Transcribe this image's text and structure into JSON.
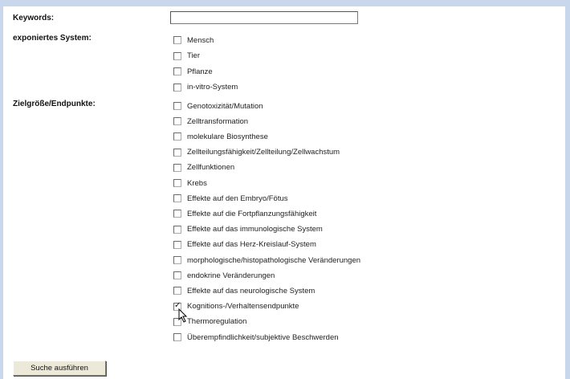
{
  "form": {
    "keywords_label": "Keywords:",
    "keywords_value": "",
    "exposed_system_label": "exponiertes System:",
    "endpoints_label": "Zielgröße/Endpunkte:",
    "submit_label": "Suche ausführen"
  },
  "exposed_systems": [
    {
      "label": "Mensch",
      "checked": false
    },
    {
      "label": "Tier",
      "checked": false
    },
    {
      "label": "Pflanze",
      "checked": false
    },
    {
      "label": "in-vitro-System",
      "checked": false
    }
  ],
  "endpoints": [
    {
      "label": "Genotoxizität/Mutation",
      "checked": false
    },
    {
      "label": "Zelltransformation",
      "checked": false
    },
    {
      "label": "molekulare Biosynthese",
      "checked": false
    },
    {
      "label": "Zellteilungsfähigkeit/Zellteilung/Zellwachstum",
      "checked": false
    },
    {
      "label": "Zellfunktionen",
      "checked": false
    },
    {
      "label": "Krebs",
      "checked": false
    },
    {
      "label": "Effekte auf den Embryo/Fötus",
      "checked": false
    },
    {
      "label": "Effekte auf die Fortpflanzungsfähigkeit",
      "checked": false
    },
    {
      "label": "Effekte auf das immunologische System",
      "checked": false
    },
    {
      "label": "Effekte auf das Herz-Kreislauf-System",
      "checked": false
    },
    {
      "label": "morphologische/histopathologische Veränderungen",
      "checked": false
    },
    {
      "label": "endokrine Veränderungen",
      "checked": false
    },
    {
      "label": "Effekte auf das neurologische System",
      "checked": false
    },
    {
      "label": "Kognitions-/Verhaltensendpunkte",
      "checked": true
    },
    {
      "label": "Thermoregulation",
      "checked": false
    },
    {
      "label": "Überempfindlichkeit/subjektive Beschwerden",
      "checked": false
    }
  ]
}
